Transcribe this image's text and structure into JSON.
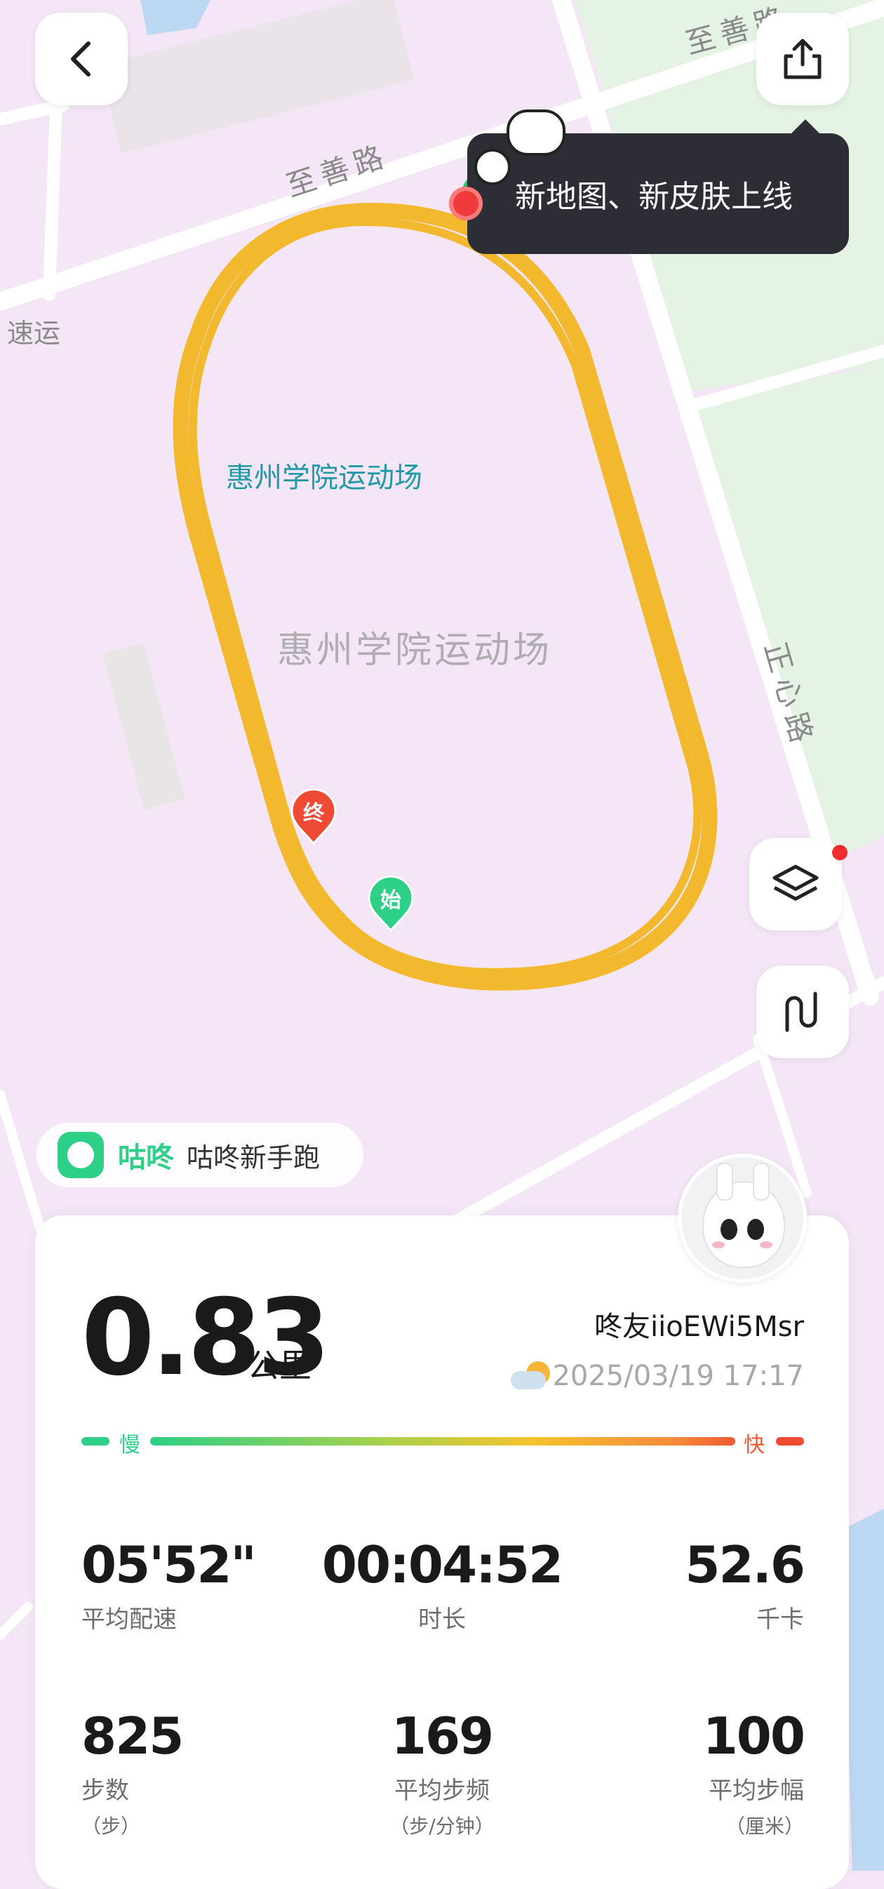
{
  "map": {
    "road_top_right": "至善路",
    "road_left": "至善路",
    "road_right": "正心路",
    "partial_label": "速运",
    "venue_label_teal": "惠州学院运动场",
    "venue_label_gray": "惠州学院运动场",
    "end_marker": "终",
    "start_marker": "始",
    "colors": {
      "track": "#f3b92e",
      "start": "#2ecf86",
      "end": "#ef4a34",
      "map_bg": "#f4e6f6",
      "green_area": "#e4f3e4"
    }
  },
  "toolbar": {
    "back_icon": "chevron-left-icon",
    "share_icon": "share-icon",
    "layers_icon": "layers-icon",
    "route_icon": "route-icon"
  },
  "tooltip": {
    "text": "新地图、新皮肤上线"
  },
  "brand": {
    "name": "咕咚",
    "tagline": "咕咚新手跑"
  },
  "summary": {
    "distance": "0.83",
    "distance_unit": "公里",
    "username": "咚友iioEWi5Msr",
    "datetime": "2025/03/19 17:17",
    "weather_icon": "partly-cloudy-icon",
    "pace_slow": "慢",
    "pace_fast": "快"
  },
  "stats": {
    "avg_pace": {
      "value": "05'52\"",
      "label": "平均配速"
    },
    "duration": {
      "value": "00:04:52",
      "label": "时长"
    },
    "calories": {
      "value": "52.6",
      "label": "千卡"
    },
    "steps": {
      "value": "825",
      "label": "步数",
      "unit": "（步）"
    },
    "cadence": {
      "value": "169",
      "label": "平均步频",
      "unit": "（步/分钟）"
    },
    "stride": {
      "value": "100",
      "label": "平均步幅",
      "unit": "（厘米）"
    }
  }
}
